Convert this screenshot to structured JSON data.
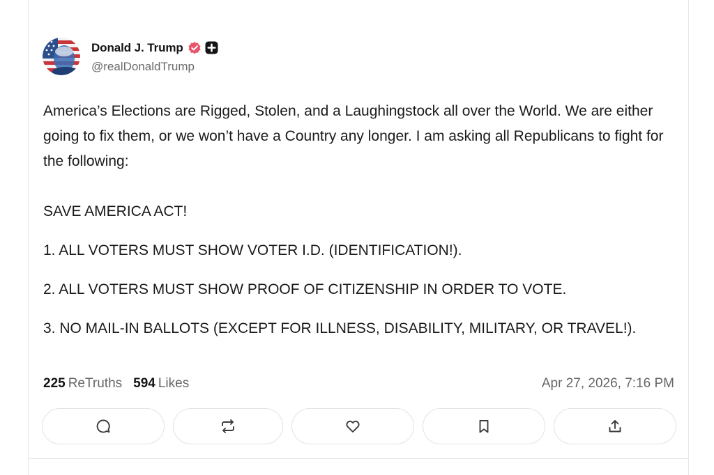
{
  "post": {
    "author": {
      "display_name": "Donald J. Trump",
      "handle": "@realDonaldTrump",
      "verified_badge_color": "#e8556a"
    },
    "body": {
      "intro": "America’s Elections are Rigged, Stolen, and a Laughingstock all over the World. We are either going to fix them, or we won’t have a Country any longer. I am asking all Republicans to fight for the following:",
      "act_title": "SAVE AMERICA ACT!",
      "items": [
        "1. ALL VOTERS MUST SHOW VOTER I.D. (IDENTIFICATION!).",
        "2. ALL VOTERS MUST SHOW PROOF OF CITIZENSHIP IN ORDER TO VOTE.",
        "3. NO MAIL-IN BALLOTS (EXCEPT FOR ILLNESS, DISABILITY, MILITARY, OR TRAVEL!)."
      ]
    },
    "stats": {
      "retruths_count": "225",
      "retruths_label": "ReTruths",
      "likes_count": "594",
      "likes_label": "Likes",
      "timestamp": "Apr 27, 2026, 7:16 PM"
    },
    "actions": [
      {
        "name": "reply-button",
        "icon": "comment-icon"
      },
      {
        "name": "retruth-button",
        "icon": "repost-icon"
      },
      {
        "name": "like-button",
        "icon": "heart-icon"
      },
      {
        "name": "bookmark-button",
        "icon": "bookmark-icon"
      },
      {
        "name": "share-button",
        "icon": "share-icon"
      }
    ]
  }
}
